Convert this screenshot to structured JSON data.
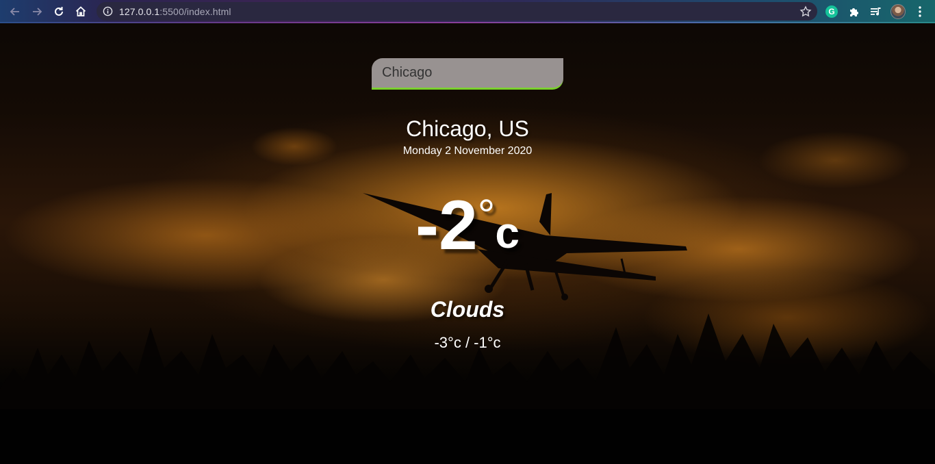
{
  "browser": {
    "url_host": "127.0.0.1",
    "url_rest": ":5500/index.html",
    "icons": {
      "back": "arrow-left-icon",
      "forward": "arrow-right-icon",
      "reload": "reload-icon",
      "home": "home-icon",
      "site_info": "info-icon",
      "bookmark": "star-icon",
      "grammarly": "grammarly-icon",
      "extensions": "puzzle-icon",
      "media": "media-queue-icon",
      "profile": "avatar",
      "menu": "kebab-menu-icon"
    },
    "grammarly_letter": "G"
  },
  "app": {
    "search_value": "Chicago",
    "location": "Chicago, US",
    "date": "Monday 2 November 2020",
    "temperature": {
      "value": "-2",
      "degree": "°",
      "unit": "c"
    },
    "weather": "Clouds",
    "hi_low": "-3°c / -1°c"
  },
  "colors": {
    "search_underline": "#7ad12c",
    "text": "#ffffff"
  }
}
